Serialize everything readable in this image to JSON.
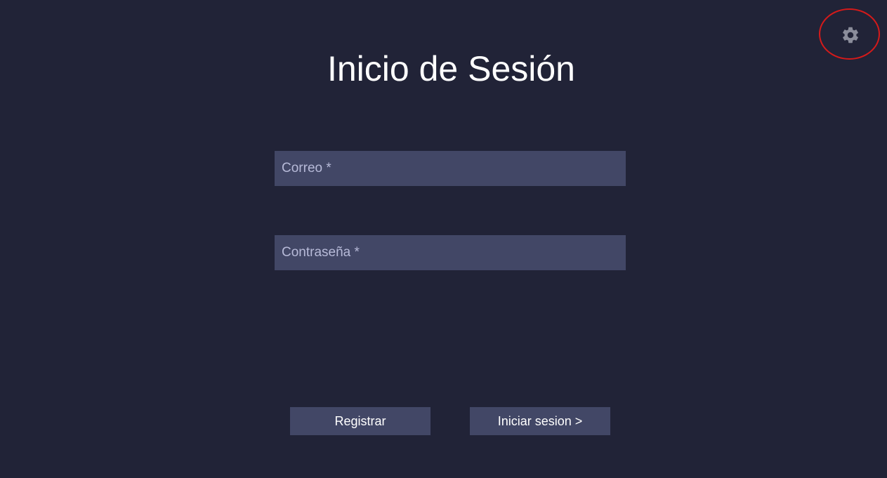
{
  "login": {
    "title": "Inicio de Sesión",
    "email_placeholder": "Correo *",
    "email_value": "",
    "password_placeholder": "Contraseña *",
    "password_value": "",
    "register_label": "Registrar",
    "login_label": "Iniciar sesion >"
  },
  "settings": {
    "icon": "gear-icon",
    "highlight_color": "#d51a1a"
  },
  "colors": {
    "background": "#212337",
    "field": "#424766",
    "text": "#ffffff"
  }
}
